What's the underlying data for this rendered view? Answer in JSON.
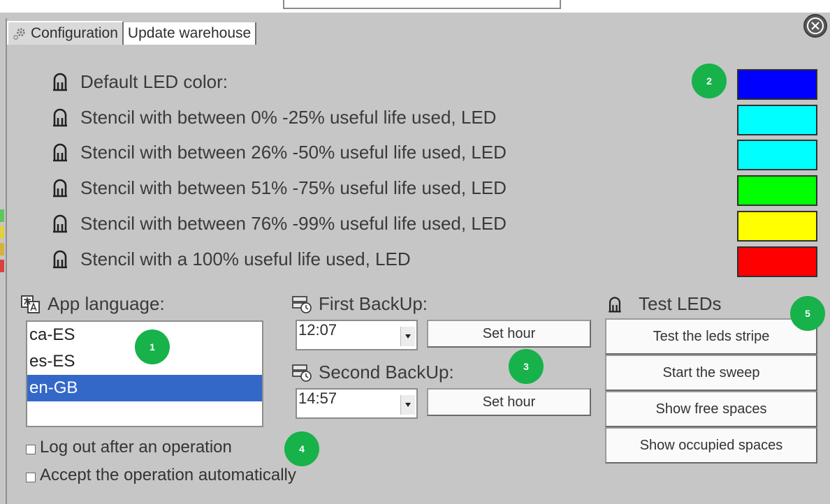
{
  "tabs": [
    {
      "label": "Configuration",
      "icon": "gear-icon",
      "active": true
    },
    {
      "label": "Update warehouse",
      "active": false
    }
  ],
  "close_icon": "close-circle-icon",
  "led_settings": [
    {
      "label": "Default LED color:",
      "color": "#0000ff"
    },
    {
      "label": "Stencil with between 0% -25% useful life used, LED",
      "color": "#00ffff"
    },
    {
      "label": "Stencil with between 26% -50% useful life used, LED",
      "color": "#00ffff"
    },
    {
      "label": "Stencil with between 51% -75% useful life used, LED",
      "color": "#00ff00"
    },
    {
      "label": "Stencil with between 76% -99% useful life used, LED",
      "color": "#ffff00"
    },
    {
      "label": "Stencil with a 100% useful life used, LED",
      "color": "#ff0000"
    }
  ],
  "language": {
    "title": "App language:",
    "options": [
      "ca-ES",
      "es-ES",
      "en-GB"
    ],
    "selected": "en-GB"
  },
  "backup": {
    "first": {
      "title": "First BackUp:",
      "time": "12:07",
      "button": "Set hour"
    },
    "second": {
      "title": "Second BackUp:",
      "time": "14:57",
      "button": "Set hour"
    }
  },
  "test_leds": {
    "title": "Test LEDs",
    "buttons": [
      "Test the leds stripe",
      "Start the sweep",
      "Show free spaces",
      "Show occupied spaces"
    ]
  },
  "options": [
    {
      "label": "Log out after an operation",
      "checked": false
    },
    {
      "label": "Accept the operation automatically",
      "checked": false
    }
  ],
  "badges": [
    "1",
    "2",
    "3",
    "4",
    "5"
  ],
  "colors": {
    "badge": "#17b24a",
    "selection": "#3468c8",
    "panel": "#c6c6c6"
  }
}
